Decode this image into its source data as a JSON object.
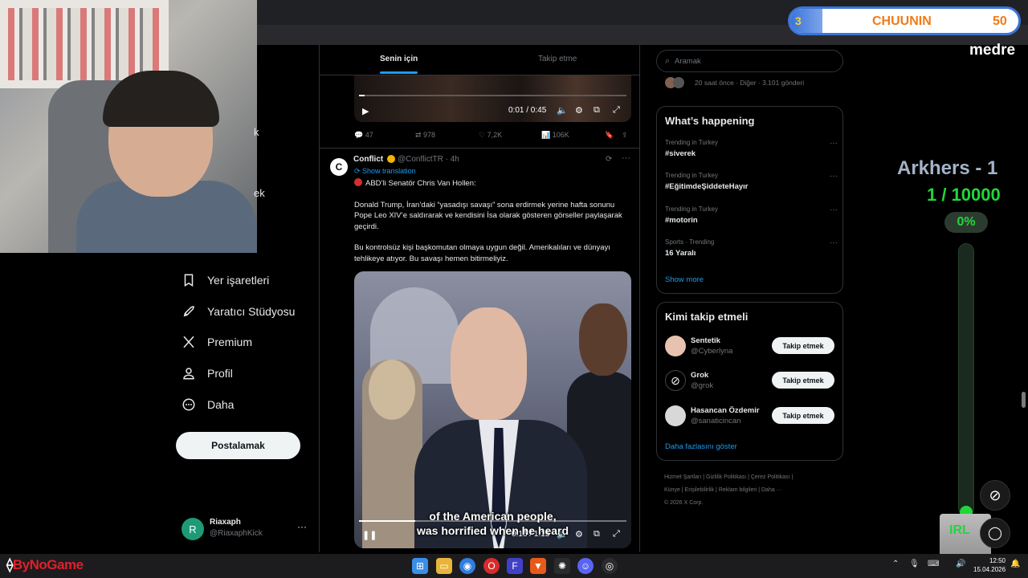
{
  "feed_tabs": {
    "for_you": "Senin için",
    "following": "Takip etme"
  },
  "top_video": {
    "time": "0:01 / 0:45",
    "progress_fraction": 0.02
  },
  "top_actions": {
    "replies": "47",
    "reposts": "978",
    "likes": "7,2K",
    "views": "106K"
  },
  "nav": {
    "partial_1": "k",
    "partial_2": "ek",
    "items": [
      {
        "label": "Yer işaretleri",
        "icon": "bookmark-icon"
      },
      {
        "label": "Yaratıcı Stüdyosu",
        "icon": "rocket-icon"
      },
      {
        "label": "Premium",
        "icon": "x-logo-icon"
      },
      {
        "label": "Profil",
        "icon": "person-icon"
      },
      {
        "label": "Daha",
        "icon": "more-circle-icon"
      }
    ],
    "post_button": "Postalamak"
  },
  "account": {
    "avatar_letter": "R",
    "name": "Riaxaph",
    "handle": "@RiaxaphKick",
    "more": "···"
  },
  "tweet": {
    "avatar_letter": "C",
    "name": "Conflict",
    "handle": "@ConflictTR · 4h",
    "show_translation": "Show translation",
    "line1": "ABD’li Senatör Chris Van Hollen:",
    "para1": "Donald Trump, İran’daki “yasadışı savaşı” sona erdirmek yerine hafta sonunu Pope Leo XIV’e saldırarak ve kendisini İsa olarak gösteren görseller paylaşarak geçirdi.",
    "para2": "Bu kontrolsüz kişi başkomutan olmaya uygun değil. Amerikalıları ve dünyayı tehlikeye atıyor. Bu savaşı hemen bitirmeliyiz.",
    "video_caption_1": "of the American people,",
    "video_caption_2": "was horrified when he heard",
    "video_time": "0:16 / 1:15",
    "video_progress_fraction": 0.21
  },
  "search": {
    "placeholder": "Aramak"
  },
  "trend_top": {
    "text": "20 saat önce · Diğer · 3.101 gönderi"
  },
  "whats_happening": {
    "title": "What’s happening",
    "trends": [
      {
        "meta": "Trending in Turkey",
        "topic": "#siverek"
      },
      {
        "meta": "Trending in Turkey",
        "topic": "#EğitimdeŞiddeteHayır"
      },
      {
        "meta": "Trending in Turkey",
        "topic": "#motorin"
      },
      {
        "meta": "Sports · Trending",
        "topic": "16 Yaralı"
      }
    ],
    "show_more": "Show more"
  },
  "who_to_follow": {
    "title": "Kimi takip etmeli",
    "users": [
      {
        "name": "Sentetik",
        "handle": "@Cyberlyna",
        "button": "Takip etmek",
        "avatar_color": "#e8c2b0"
      },
      {
        "name": "Grok",
        "handle": "@grok",
        "button": "Takip etmek",
        "avatar_color": "#000000"
      },
      {
        "name": "Hasancan Özdemir",
        "handle": "@sanaticincan",
        "button": "Takip etmek",
        "avatar_color": "#d8d8d8"
      }
    ],
    "show_more": "Daha fazlasını göster"
  },
  "footer": {
    "line1": "Hizmet Şartları  |  Gizlilik Politikası  |  Çerez Politikası  |",
    "line2": "Künye  |  Erişilebilirlik  |  Reklam bilgileri  |  Daha ···",
    "line3": "© 2026 X Corp."
  },
  "overlay": {
    "level": "3",
    "rank": "CHUUNIN",
    "rank_value": "50",
    "medre": "medre",
    "goal_title": "Arkhers - 1",
    "goal_count": "1 / 10000",
    "goal_pct": "0%",
    "irl": "IRL"
  },
  "taskbar": {
    "brand": "ByNoGame",
    "time": "12:50",
    "date": "15.04.2026"
  },
  "colors": {
    "accent": "#1d9bf0",
    "background": "#000000",
    "goal_green": "#22d63a",
    "rank_orange": "#f07b1a"
  }
}
